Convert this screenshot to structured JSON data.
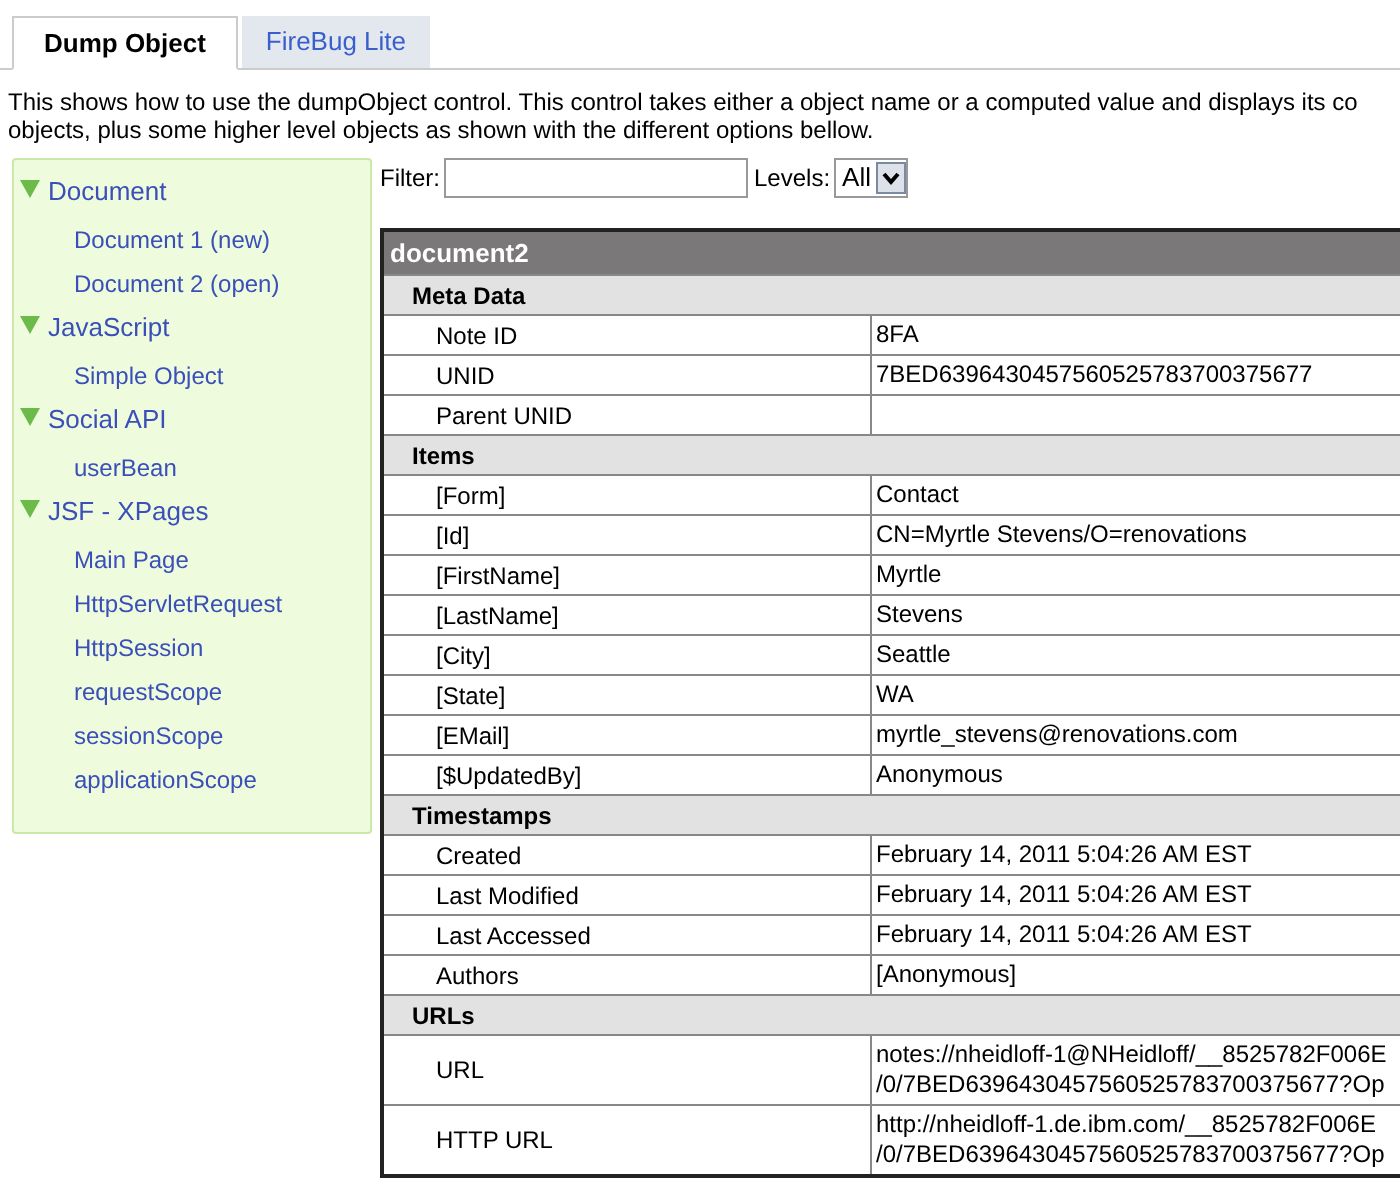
{
  "tabs": [
    {
      "label": "Dump Object",
      "selected": true
    },
    {
      "label": "FireBug Lite",
      "selected": false
    }
  ],
  "description": [
    "This shows how to use the dumpObject control. This control takes either a object name or a computed value and displays its co",
    "objects, plus some higher level objects as shown with the different options bellow."
  ],
  "sidebar": {
    "items": [
      {
        "label": "Document",
        "expanded": true,
        "children": [
          {
            "label": "Document 1 (new)"
          },
          {
            "label": "Document 2 (open)"
          }
        ]
      },
      {
        "label": "JavaScript",
        "expanded": true,
        "children": [
          {
            "label": "Simple Object"
          }
        ]
      },
      {
        "label": "Social API",
        "expanded": true,
        "children": [
          {
            "label": "userBean"
          }
        ]
      },
      {
        "label": "JSF - XPages",
        "expanded": true,
        "children": [
          {
            "label": "Main Page"
          },
          {
            "label": "HttpServletRequest"
          },
          {
            "label": "HttpSession"
          },
          {
            "label": "requestScope"
          },
          {
            "label": "sessionScope"
          },
          {
            "label": "applicationScope"
          }
        ]
      }
    ]
  },
  "filter": {
    "label": "Filter:"
  },
  "levels": {
    "label": "Levels:",
    "value": "All"
  },
  "table": {
    "title": "document2",
    "sections": [
      {
        "title": "Meta Data",
        "rows": [
          {
            "name": "Note ID",
            "value": [
              "8FA"
            ]
          },
          {
            "name": "UNID",
            "value": [
              "7BED6396430457560525783700375677"
            ]
          },
          {
            "name": "Parent UNID",
            "value": []
          }
        ]
      },
      {
        "title": "Items",
        "rows": [
          {
            "name": "[Form]",
            "value": [
              "Contact"
            ]
          },
          {
            "name": "[Id]",
            "value": [
              "CN=Myrtle Stevens/O=renovations"
            ]
          },
          {
            "name": "[FirstName]",
            "value": [
              "Myrtle"
            ]
          },
          {
            "name": "[LastName]",
            "value": [
              "Stevens"
            ]
          },
          {
            "name": "[City]",
            "value": [
              "Seattle"
            ]
          },
          {
            "name": "[State]",
            "value": [
              "WA"
            ]
          },
          {
            "name": "[EMail]",
            "value": [
              "myrtle_stevens@renovations.com"
            ]
          },
          {
            "name": "[$UpdatedBy]",
            "value": [
              "Anonymous"
            ]
          }
        ]
      },
      {
        "title": "Timestamps",
        "rows": [
          {
            "name": "Created",
            "value": [
              "February 14, 2011 5:04:26 AM EST"
            ]
          },
          {
            "name": "Last Modified",
            "value": [
              "February 14, 2011 5:04:26 AM EST"
            ]
          },
          {
            "name": "Last Accessed",
            "value": [
              "February 14, 2011 5:04:26 AM EST"
            ]
          },
          {
            "name": "Authors",
            "value": [
              "[Anonymous]"
            ]
          }
        ]
      },
      {
        "title": "URLs",
        "rows": [
          {
            "name": "URL",
            "value": [
              "notes://nheidloff-1@NHeidloff/__8525782F006E",
              "/0/7BED6396430457560525783700375677?Op"
            ]
          },
          {
            "name": "HTTP URL",
            "value": [
              "http://nheidloff-1.de.ibm.com/__8525782F006E",
              "/0/7BED6396430457560525783700375677?Op"
            ]
          }
        ]
      }
    ]
  }
}
